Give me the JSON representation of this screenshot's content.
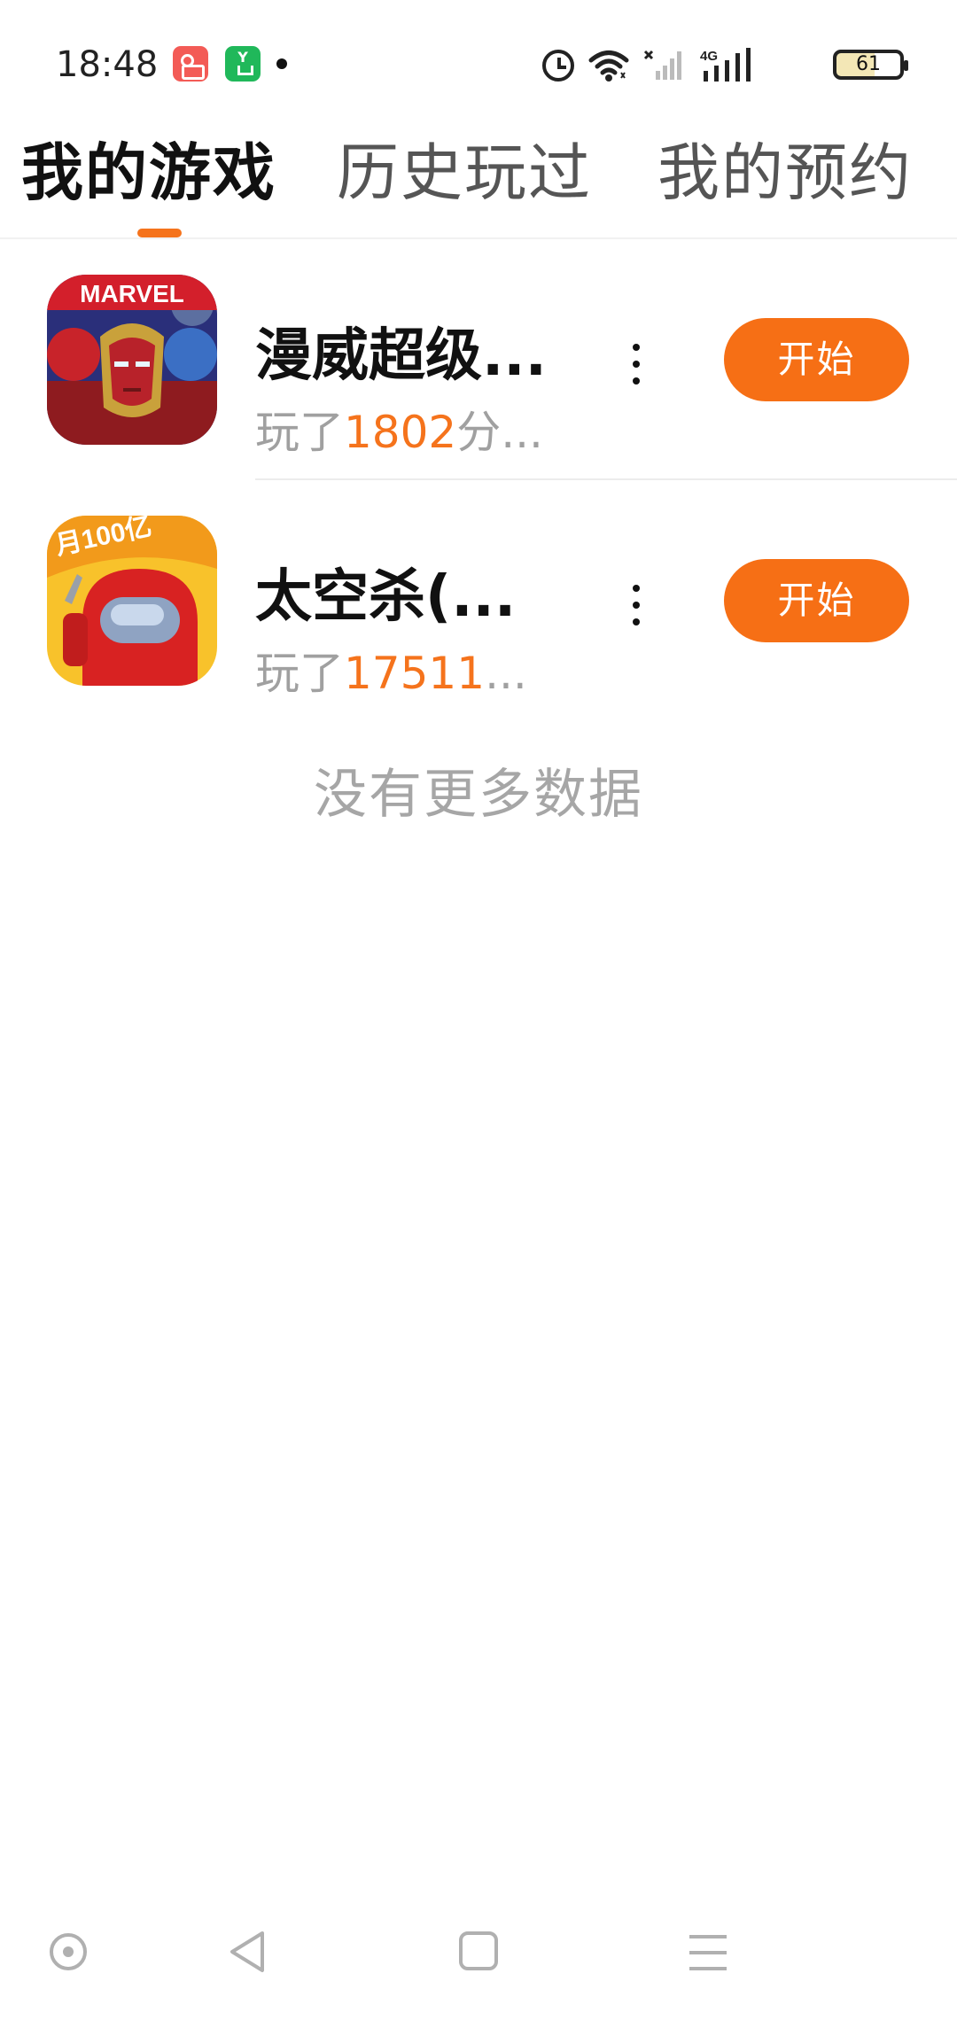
{
  "status_bar": {
    "time": "18:48",
    "battery": "61",
    "network_label": "4G",
    "icons": [
      "kuaishou-app-icon",
      "green-app-icon",
      "notification-dot",
      "alarm-icon",
      "wifi-icon",
      "no-signal-sim-icon",
      "cellular-signal-icon",
      "battery-icon"
    ]
  },
  "tabs": [
    {
      "label": "我的游戏",
      "active": true
    },
    {
      "label": "历史玩过",
      "active": false
    },
    {
      "label": "我的预约",
      "active": false
    }
  ],
  "games": [
    {
      "name": "漫威超级...",
      "play_prefix": "玩了",
      "play_value": "1802",
      "play_suffix": "分...",
      "icon_text": "MARVEL",
      "button_label": "开始"
    },
    {
      "name": "太空杀(...",
      "play_prefix": "玩了",
      "play_value": "17511",
      "play_suffix": "...",
      "icon_text": "月100亿",
      "button_label": "开始"
    }
  ],
  "no_more_text": "没有更多数据",
  "colors": {
    "accent": "#f66f15",
    "text_primary": "#111111",
    "text_secondary": "#a0a0a0"
  },
  "nav_bar": {
    "icons": [
      "assistant-icon",
      "back-icon",
      "home-icon",
      "recents-icon"
    ]
  }
}
